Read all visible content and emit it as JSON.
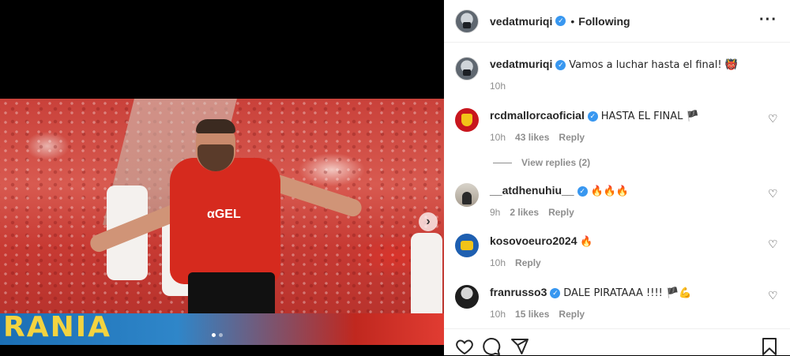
{
  "post": {
    "author": "vedatmuriqi",
    "follow_sep": "•",
    "follow_status": "Following",
    "caption": "Vamos a luchar hasta el final! 👹",
    "caption_time": "10h",
    "image": {
      "sponsor_text": "αGEL",
      "board_text": "RANIA"
    }
  },
  "comments": [
    {
      "user": "rcdmallorcaoficial",
      "verified": true,
      "text": "HASTA EL FINAL 🏴",
      "time": "10h",
      "likes": "43 likes",
      "reply": "Reply",
      "avatar": "mallorca-crest"
    },
    {
      "user": "__atdhenuhiu__",
      "verified": true,
      "text": "🔥🔥🔥",
      "time": "9h",
      "likes": "2 likes",
      "reply": "Reply",
      "avatar": "person"
    },
    {
      "user": "kosovoeuro2024",
      "verified": false,
      "text": "🔥",
      "time": "10h",
      "likes": "",
      "reply": "Reply",
      "avatar": "kosovo-logo"
    },
    {
      "user": "franrusso3",
      "verified": true,
      "text": "DALE PIRATAAA !!!! 🏴💪",
      "time": "10h",
      "likes": "15 likes",
      "reply": "Reply",
      "avatar": "person"
    }
  ],
  "view_replies": "View replies (2)",
  "icons": {
    "more": "more-options-icon",
    "heart": "heart-icon",
    "verified": "verified-badge-icon",
    "like": "like-icon",
    "comment": "comment-icon",
    "share": "share-icon",
    "save": "save-icon",
    "next": "next-arrow-icon"
  },
  "colors": {
    "verified": "#3897f0",
    "meta_text": "#8e8e8e",
    "primary_text": "#262626",
    "jersey": "#d62a1e"
  }
}
